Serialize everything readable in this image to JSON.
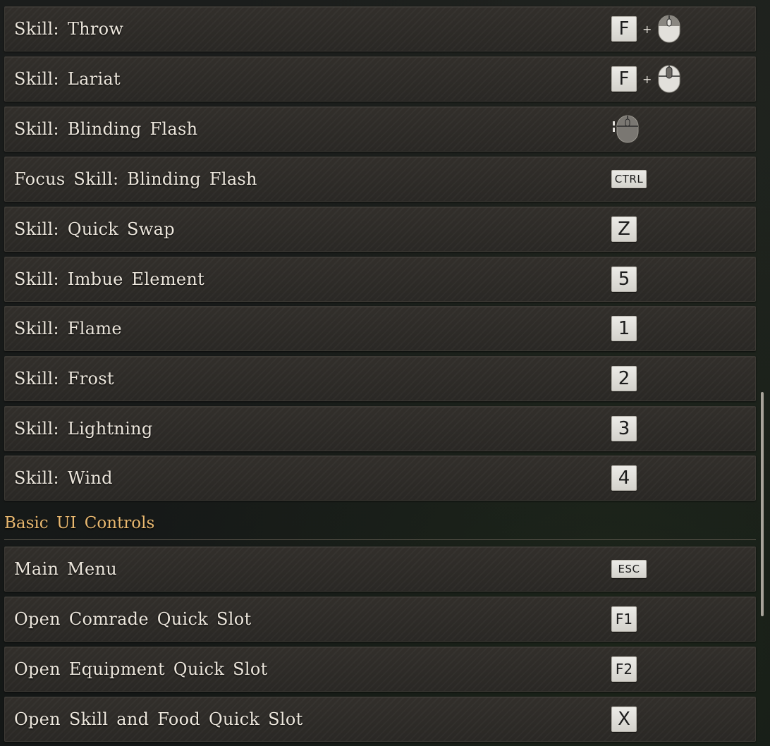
{
  "skills": [
    {
      "label": "Skill: Throw",
      "keys": [
        "F",
        "+",
        "mouse-left-right"
      ]
    },
    {
      "label": "Skill: Lariat",
      "keys": [
        "F",
        "+",
        "mouse-wheel"
      ]
    },
    {
      "label": "Skill: Blinding Flash",
      "keys": [
        "mouse-right-side"
      ]
    },
    {
      "label": "Focus Skill: Blinding Flash",
      "keys": [
        "CTRL"
      ]
    },
    {
      "label": "Skill: Quick Swap",
      "keys": [
        "Z"
      ]
    },
    {
      "label": "Skill: Imbue Element",
      "keys": [
        "5"
      ]
    },
    {
      "label": "Skill: Flame",
      "keys": [
        "1"
      ]
    },
    {
      "label": "Skill: Frost",
      "keys": [
        "2"
      ]
    },
    {
      "label": "Skill: Lightning",
      "keys": [
        "3"
      ]
    },
    {
      "label": "Skill: Wind",
      "keys": [
        "4"
      ]
    }
  ],
  "section": {
    "title": "Basic UI Controls"
  },
  "ui_controls": [
    {
      "label": "Main Menu",
      "keys": [
        "ESC"
      ]
    },
    {
      "label": "Open Comrade Quick Slot",
      "keys": [
        "F1"
      ]
    },
    {
      "label": "Open Equipment Quick Slot",
      "keys": [
        "F2"
      ]
    },
    {
      "label": "Open Skill and Food Quick Slot",
      "keys": [
        "X"
      ]
    }
  ],
  "colors": {
    "section_title": "#e8b870",
    "key_cap": "#e2e0db",
    "row_bg": "#2e2c28"
  }
}
